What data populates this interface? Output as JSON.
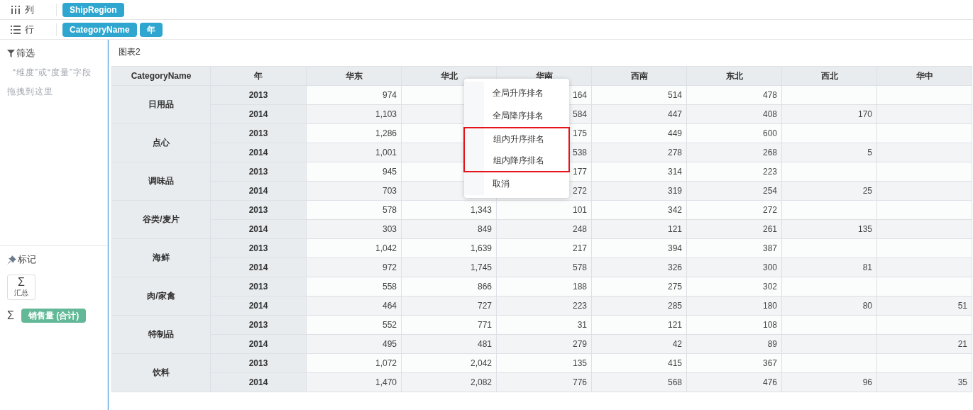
{
  "shelves": [
    {
      "kind": "columns",
      "label": "列",
      "pills": [
        "ShipRegion"
      ]
    },
    {
      "kind": "rows",
      "label": "行",
      "pills": [
        "CategoryName",
        "年"
      ]
    }
  ],
  "filter": {
    "title": "筛选",
    "hint": "“维度”或“度量”字段拖拽到这里"
  },
  "marks": {
    "title": "标记",
    "button": {
      "symbol": "Σ",
      "label": "汇总"
    },
    "measure": {
      "symbol": "Σ",
      "label": "销售量 (合计)"
    }
  },
  "chart": {
    "title": "图表2",
    "columns": [
      "CategoryName",
      "年",
      "华东",
      "华北",
      "华南",
      "西南",
      "东北",
      "西北",
      "华中"
    ],
    "groups": [
      {
        "name": "日用品",
        "rows": [
          {
            "year": "2013",
            "cells": [
              "974",
              null,
              "164",
              "514",
              "478",
              null,
              null
            ]
          },
          {
            "year": "2014",
            "cells": [
              "1,103",
              null,
              "584",
              "447",
              "408",
              "170",
              null
            ]
          }
        ]
      },
      {
        "name": "点心",
        "rows": [
          {
            "year": "2013",
            "cells": [
              "1,286",
              null,
              "175",
              "449",
              "600",
              null,
              null
            ]
          },
          {
            "year": "2014",
            "cells": [
              "1,001",
              null,
              "538",
              "278",
              "268",
              "5",
              null
            ]
          }
        ]
      },
      {
        "name": "调味品",
        "rows": [
          {
            "year": "2013",
            "cells": [
              "945",
              null,
              "177",
              "314",
              "223",
              null,
              null
            ]
          },
          {
            "year": "2014",
            "cells": [
              "703",
              null,
              "272",
              "319",
              "254",
              "25",
              null
            ]
          }
        ]
      },
      {
        "name": "谷类/麦片",
        "rows": [
          {
            "year": "2013",
            "cells": [
              "578",
              "1,343",
              "101",
              "342",
              "272",
              null,
              null
            ]
          },
          {
            "year": "2014",
            "cells": [
              "303",
              "849",
              "248",
              "121",
              "261",
              "135",
              null
            ]
          }
        ]
      },
      {
        "name": "海鲜",
        "rows": [
          {
            "year": "2013",
            "cells": [
              "1,042",
              "1,639",
              "217",
              "394",
              "387",
              null,
              null
            ]
          },
          {
            "year": "2014",
            "cells": [
              "972",
              "1,745",
              "578",
              "326",
              "300",
              "81",
              null
            ]
          }
        ]
      },
      {
        "name": "肉/家禽",
        "rows": [
          {
            "year": "2013",
            "cells": [
              "558",
              "866",
              "188",
              "275",
              "302",
              null,
              null
            ]
          },
          {
            "year": "2014",
            "cells": [
              "464",
              "727",
              "223",
              "285",
              "180",
              "80",
              "51"
            ]
          }
        ]
      },
      {
        "name": "特制品",
        "rows": [
          {
            "year": "2013",
            "cells": [
              "552",
              "771",
              "31",
              "121",
              "108",
              null,
              null
            ]
          },
          {
            "year": "2014",
            "cells": [
              "495",
              "481",
              "279",
              "42",
              "89",
              null,
              "21"
            ]
          }
        ]
      },
      {
        "name": "饮料",
        "rows": [
          {
            "year": "2013",
            "cells": [
              "1,072",
              "2,042",
              "135",
              "415",
              "367",
              null,
              null
            ]
          },
          {
            "year": "2014",
            "cells": [
              "1,470",
              "2,082",
              "776",
              "568",
              "476",
              "96",
              "35"
            ]
          }
        ]
      }
    ]
  },
  "context_menu": {
    "items": [
      {
        "label": "全局升序排名",
        "outlined": false
      },
      {
        "label": "全局降序排名",
        "outlined": false
      },
      {
        "label": "组内升序排名",
        "outlined": true
      },
      {
        "label": "组内降序排名",
        "outlined": true
      },
      {
        "label": "取消",
        "outlined": false
      }
    ]
  }
}
